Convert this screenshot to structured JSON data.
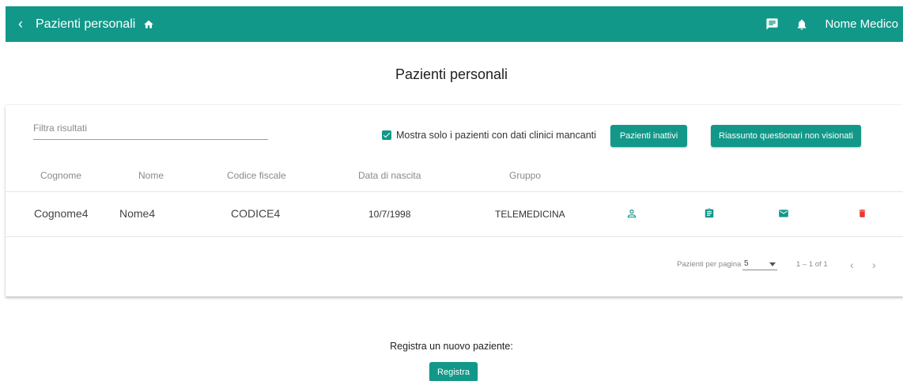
{
  "header": {
    "back_label": "‹",
    "title": "Pazienti personali",
    "doctor_name": "Nome Medico"
  },
  "page_title": "Pazienti personali",
  "filter": {
    "placeholder": "Filtra risultati"
  },
  "missing_data_checkbox": {
    "label": "Mostra solo i pazienti con dati clinici mancanti",
    "checked": true
  },
  "buttons": {
    "inactive": "Pazienti inattivi",
    "summary": "Riassunto questionari non visionati",
    "register": "Registra"
  },
  "table": {
    "columns": [
      "Cognome",
      "Nome",
      "Codice fiscale",
      "Data di nascita",
      "Gruppo"
    ],
    "rows": [
      {
        "cognome": "Cognome4",
        "nome": "Nome4",
        "codice_fiscale": "CODICE4",
        "data_nascita": "10/7/1998",
        "gruppo": "TELEMEDICINA",
        "actions": [
          "person-icon",
          "clipboard-icon",
          "mail-icon",
          "delete-icon"
        ]
      }
    ]
  },
  "pagination": {
    "per_page_label": "Pazienti per pagina",
    "per_page_value": "5",
    "range": "1 – 1 of 1",
    "prev": "‹",
    "next": "›"
  },
  "register": {
    "label": "Registra un nuovo paziente:"
  },
  "colors": {
    "primary": "#129889",
    "delete": "#e53935"
  }
}
